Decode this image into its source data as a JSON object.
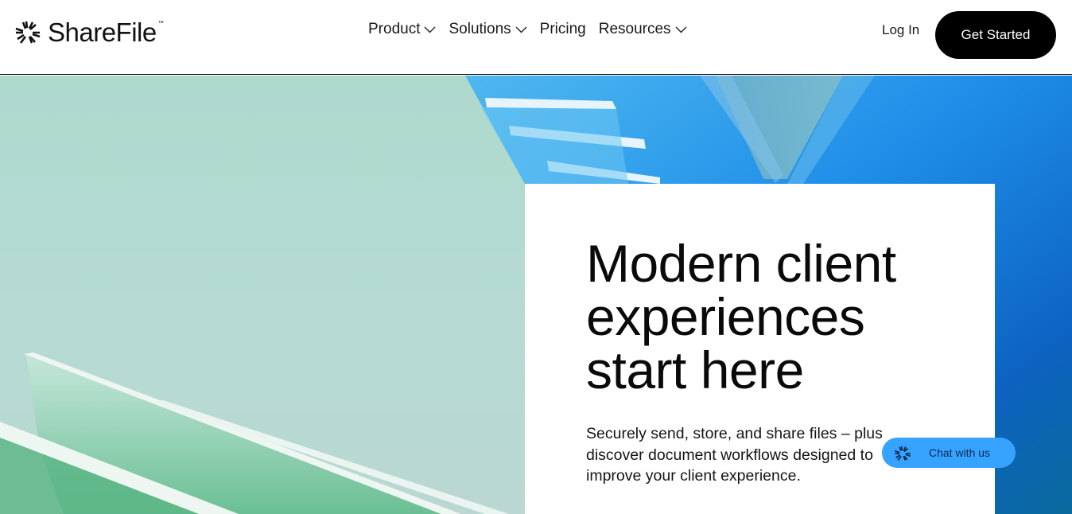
{
  "brand": {
    "name": "ShareFile",
    "trademark": "™",
    "logo_icon": "sharefile-burst-icon"
  },
  "nav": {
    "items": [
      {
        "label": "Product",
        "has_dropdown": true,
        "icon": "chevron-down-icon"
      },
      {
        "label": "Solutions",
        "has_dropdown": true,
        "icon": "chevron-down-icon"
      },
      {
        "label": "Pricing",
        "has_dropdown": false
      },
      {
        "label": "Resources",
        "has_dropdown": true,
        "icon": "chevron-down-icon"
      }
    ],
    "login_label": "Log In",
    "cta_label": "Get Started"
  },
  "hero": {
    "headline": "Modern client experiences start here",
    "subtext": "Securely send, store, and share files – plus discover document workflows designed to improve your client experience."
  },
  "chat_widget": {
    "label": "Chat with us",
    "icon": "sharefile-burst-icon"
  },
  "colors": {
    "cta_bg": "#000000",
    "chat_bg": "#35a3ff",
    "hero_mint": "#aed9cd",
    "hero_blue": "#1a7fe0"
  }
}
